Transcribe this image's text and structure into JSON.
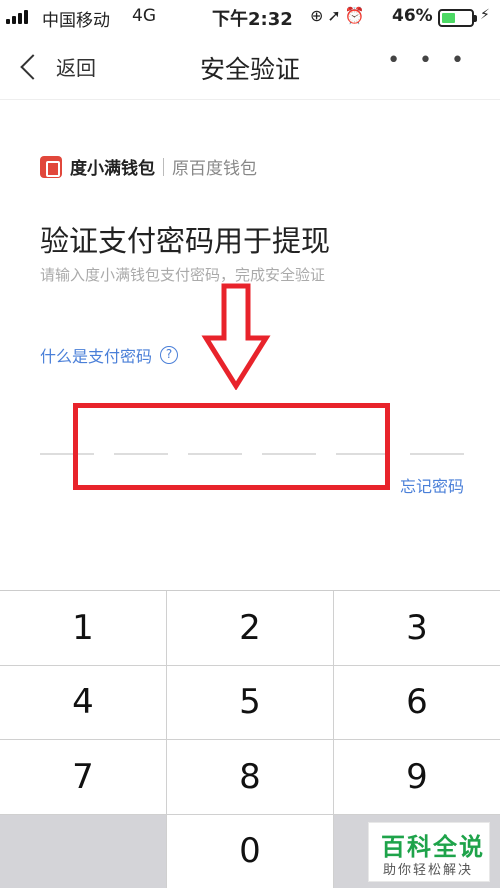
{
  "status_bar": {
    "carrier": "中国移动",
    "network": "4G",
    "time": "下午2:32",
    "battery_percent": "46%",
    "battery_level": 0.46,
    "icons": [
      "rotation-lock-icon",
      "location-icon",
      "alarm-icon",
      "charging-icon"
    ]
  },
  "nav": {
    "back_label": "返回",
    "title": "安全验证",
    "more_label": "• • •"
  },
  "brand": {
    "name": "度小满钱包",
    "sub": "原百度钱包",
    "logo_color": "#e1473b"
  },
  "main": {
    "heading": "验证支付密码用于提现",
    "subtitle": "请输入度小满钱包支付密码，完成安全验证",
    "help_link": "什么是支付密码",
    "help_icon": "?",
    "forgot_link": "忘记密码",
    "password_length": 6,
    "link_color": "#4a7fd8"
  },
  "keypad": {
    "keys": [
      "1",
      "2",
      "3",
      "4",
      "5",
      "6",
      "7",
      "8",
      "9",
      "",
      "0",
      ""
    ]
  },
  "annotation": {
    "color": "#e8232b"
  },
  "watermark": {
    "title": "百科全说",
    "subtitle": "助你轻松解决"
  }
}
